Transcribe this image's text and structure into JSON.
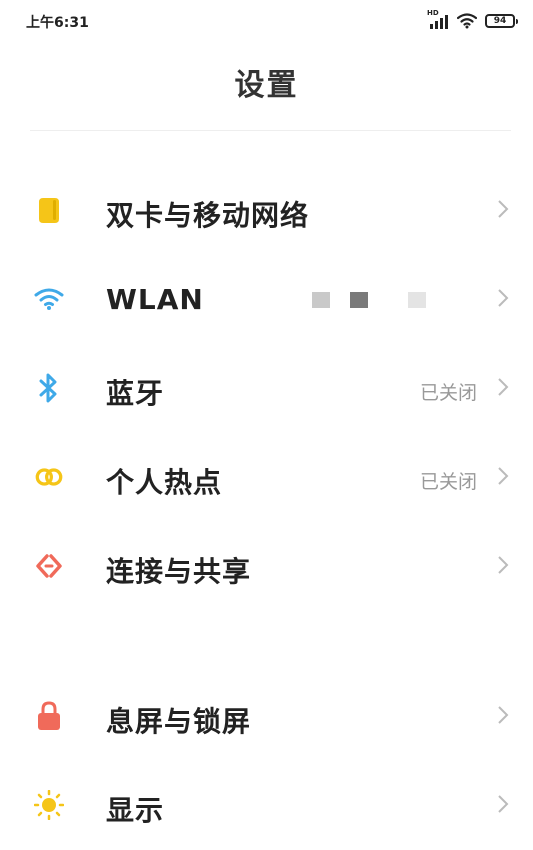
{
  "status_bar": {
    "time": "上午6:31",
    "hd_label": "HD",
    "battery_level": "94",
    "icons": [
      "signal-hd-icon",
      "wifi-icon",
      "battery-icon"
    ]
  },
  "header": {
    "title": "设置"
  },
  "settings": {
    "items": [
      {
        "label": "双卡与移动网络",
        "value": "",
        "icon": "sim-card-icon",
        "icon_color": "#F5C518"
      },
      {
        "label": "WLAN",
        "value": "",
        "icon": "wifi-icon",
        "icon_color": "#3FA9E8"
      },
      {
        "label": "蓝牙",
        "value": "已关闭",
        "icon": "bluetooth-icon",
        "icon_color": "#3FA9E8"
      },
      {
        "label": "个人热点",
        "value": "已关闭",
        "icon": "hotspot-icon",
        "icon_color": "#F5C518"
      },
      {
        "label": "连接与共享",
        "value": "",
        "icon": "connection-share-icon",
        "icon_color": "#F06A5A"
      },
      {
        "label": "息屏与锁屏",
        "value": "",
        "icon": "lock-icon",
        "icon_color": "#F06A5A"
      },
      {
        "label": "显示",
        "value": "",
        "icon": "display-sun-icon",
        "icon_color": "#F5C518"
      }
    ]
  }
}
